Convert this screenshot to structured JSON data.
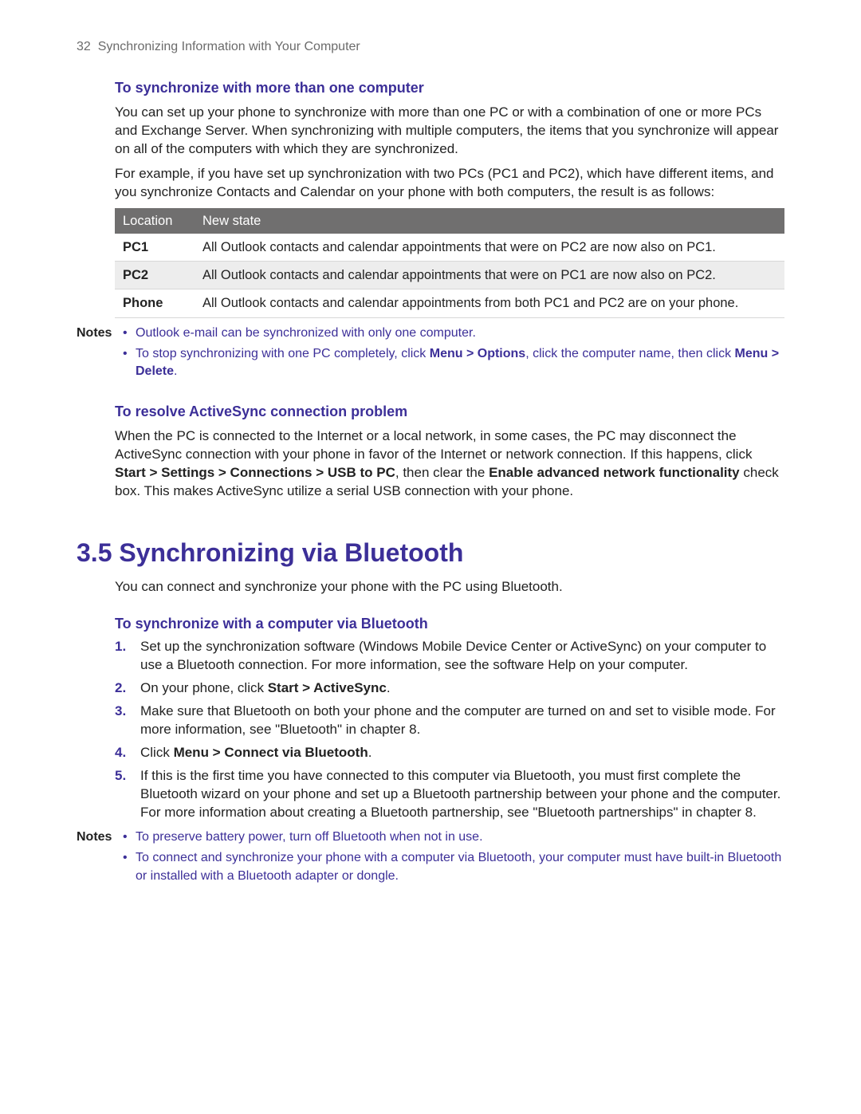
{
  "header": {
    "page_number": "32",
    "chapter_title": "Synchronizing Information with Your Computer"
  },
  "sec1": {
    "heading": "To synchronize with more than one computer",
    "p1": "You can set up your phone to synchronize with more than one PC or with a combination of one or more PCs and Exchange Server. When synchronizing with multiple computers, the items that you synchronize will appear on all of the computers with which they are synchronized.",
    "p2": "For example, if you have set up synchronization with two PCs (PC1 and PC2), which have different items, and you synchronize Contacts and Calendar on your phone with both computers, the result is as follows:",
    "table": {
      "th1": "Location",
      "th2": "New state",
      "rows": [
        {
          "loc": "PC1",
          "state": "All Outlook contacts and calendar appointments that were on PC2 are now also on PC1."
        },
        {
          "loc": "PC2",
          "state": "All Outlook contacts and calendar appointments that were on PC1 are now also on PC2."
        },
        {
          "loc": "Phone",
          "state": "All Outlook contacts and calendar appointments from both PC1 and PC2 are on your phone."
        }
      ]
    },
    "notes_label": "Notes",
    "notes": {
      "n1": "Outlook e-mail can be synchronized with only one computer.",
      "n2_pre": "To stop synchronizing with one PC completely, click ",
      "n2_b1": "Menu > Options",
      "n2_mid": ", click the computer name, then click ",
      "n2_b2": "Menu > Delete",
      "n2_post": "."
    }
  },
  "sec2": {
    "heading": "To resolve ActiveSync connection problem",
    "p1_pre": "When the PC is connected to the Internet or a local network, in some cases, the PC may disconnect the ActiveSync connection with your phone in favor of the Internet or network connection. If this happens, click ",
    "p1_b1": "Start > Settings > Connections > USB to PC",
    "p1_mid": ", then clear the ",
    "p1_b2": "Enable advanced network functionality",
    "p1_post": " check box. This makes ActiveSync utilize a serial USB connection with your phone."
  },
  "h2": "3.5  Synchronizing via Bluetooth",
  "sec3": {
    "intro": "You can connect and synchronize your phone with the PC using Bluetooth.",
    "heading": "To synchronize with a computer via Bluetooth",
    "steps": {
      "s1": "Set up the synchronization software (Windows Mobile Device Center or ActiveSync) on your computer to use a Bluetooth connection. For more information, see the software Help on your computer.",
      "s2_pre": "On your phone, click ",
      "s2_b": "Start > ActiveSync",
      "s2_post": ".",
      "s3": "Make sure that Bluetooth on both your phone and the computer are turned on and set to visible mode. For more information, see \"Bluetooth\" in chapter 8.",
      "s4_pre": "Click ",
      "s4_b": "Menu > Connect via Bluetooth",
      "s4_post": ".",
      "s5": "If this is the first time you have connected to this computer via Bluetooth, you must first complete the Bluetooth wizard on your phone and set up a Bluetooth partnership between your phone and the computer. For more information about creating a Bluetooth partnership, see \"Bluetooth partnerships\" in chapter 8."
    },
    "notes_label": "Notes",
    "notes": {
      "n1": "To preserve battery power, turn off Bluetooth when not in use.",
      "n2": "To connect and synchronize your phone with a computer via Bluetooth, your computer must have built-in Bluetooth or installed with a Bluetooth adapter or dongle."
    }
  }
}
